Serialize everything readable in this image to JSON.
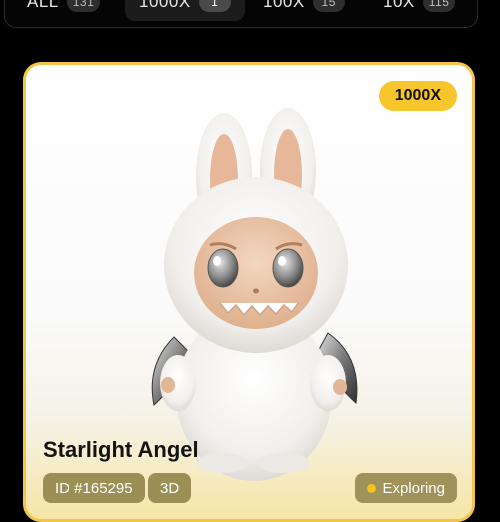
{
  "tabs": [
    {
      "label": "ALL",
      "count": "131"
    },
    {
      "label": "1000X",
      "count": "1"
    },
    {
      "label": "100X",
      "count": "15"
    },
    {
      "label": "10X",
      "count": "115"
    }
  ],
  "active_tab": "1000X",
  "card": {
    "tier_badge": "1000X",
    "title": "Starlight Angel",
    "id_label": "ID #165295",
    "type_label": "3D",
    "status_label": "Exploring"
  },
  "colors": {
    "accent": "#f7c52c",
    "card_border": "#f3c64a",
    "chip_bg": "#9b8f55",
    "background": "#000000"
  }
}
